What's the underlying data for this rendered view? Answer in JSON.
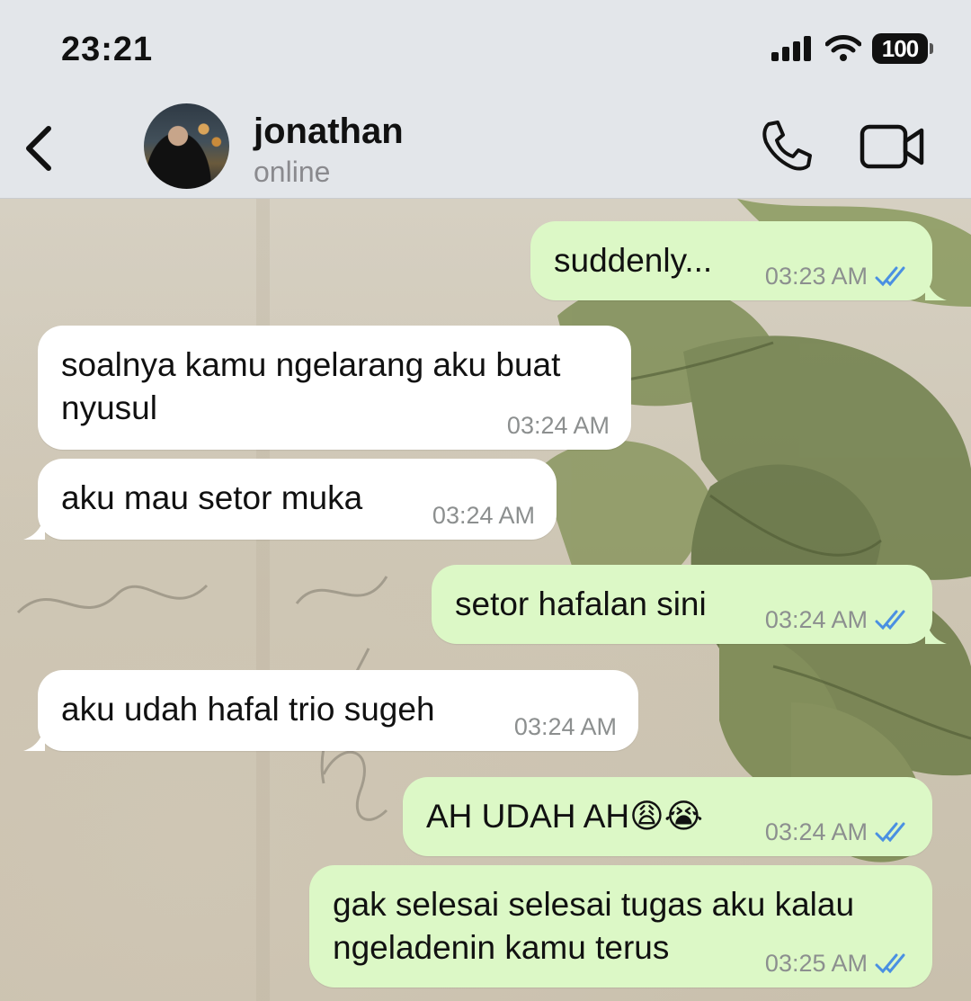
{
  "status_bar": {
    "time": "23:21",
    "battery": "100"
  },
  "header": {
    "contact_name": "jonathan",
    "contact_status": "online"
  },
  "colors": {
    "outgoing_bubble": "#dcf8c6",
    "incoming_bubble": "#ffffff",
    "read_ticks": "#4a90e2",
    "header_bg": "#e3e6ea"
  },
  "messages": [
    {
      "direction": "out",
      "text": "suddenly...",
      "time": "03:23 AM",
      "status": "read"
    },
    {
      "direction": "in",
      "line1": "soalnya kamu ngelarang aku buat",
      "line2": "nyusul",
      "time": "03:24 AM"
    },
    {
      "direction": "in",
      "text": "aku mau setor muka",
      "time": "03:24 AM"
    },
    {
      "direction": "out",
      "text": "setor hafalan sini",
      "time": "03:24 AM",
      "status": "read"
    },
    {
      "direction": "in",
      "text": "aku udah hafal trio sugeh",
      "time": "03:24 AM"
    },
    {
      "direction": "out",
      "text": "AH UDAH AH😩😭",
      "time": "03:24 AM",
      "status": "read"
    },
    {
      "direction": "out",
      "line1": "gak selesai selesai tugas aku kalau",
      "line2": "ngeladenin kamu terus",
      "time": "03:25 AM",
      "status": "read"
    }
  ]
}
